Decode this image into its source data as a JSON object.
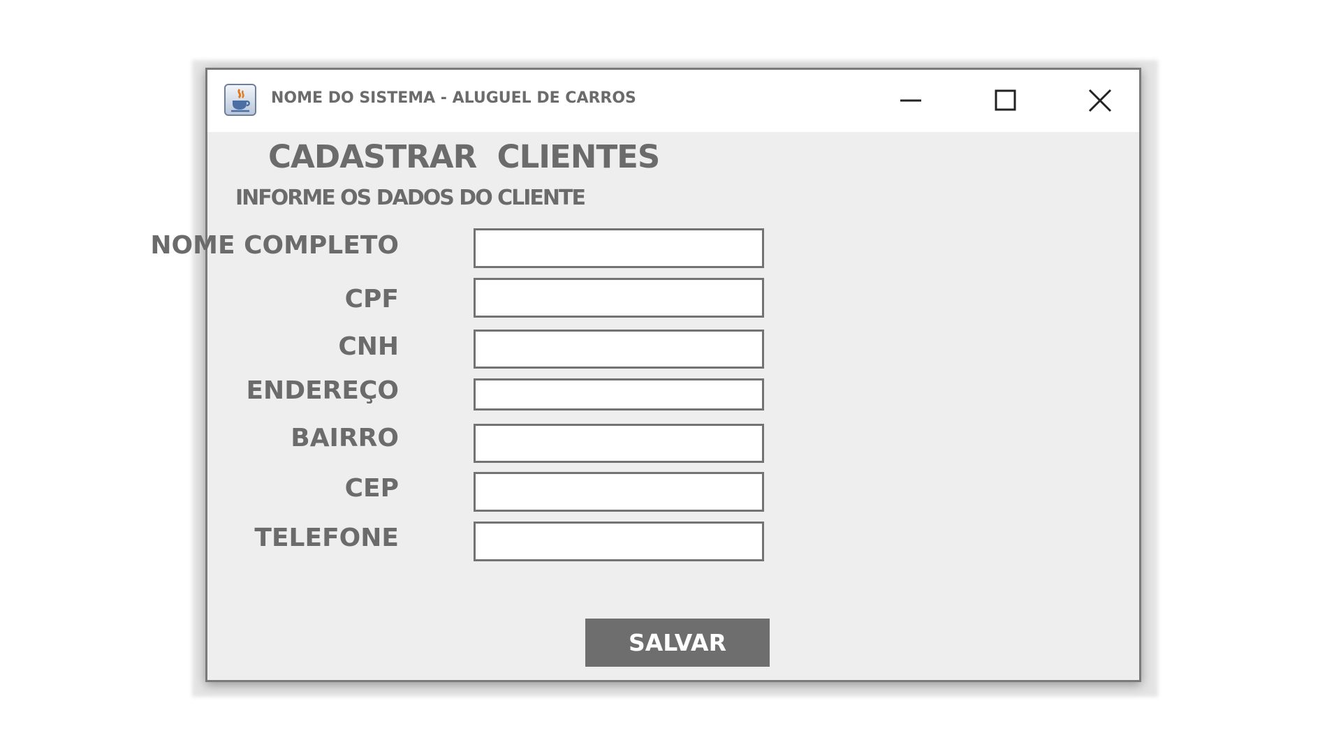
{
  "window": {
    "title": "NOME DO SISTEMA - ALUGUEL DE CARROS",
    "icon": "java-cup-icon",
    "controls": [
      "minimize-icon",
      "maximize-icon",
      "close-icon"
    ]
  },
  "form": {
    "heading": "CADASTRAR  CLIENTES",
    "subheading": "INFORME OS DADOS DO CLIENTE",
    "fields": [
      {
        "label": "NOME COMPLETO",
        "value": ""
      },
      {
        "label": "CPF",
        "value": ""
      },
      {
        "label": "CNH",
        "value": ""
      },
      {
        "label": "ENDEREÇO",
        "value": ""
      },
      {
        "label": "BAIRRO",
        "value": ""
      },
      {
        "label": "CEP",
        "value": ""
      },
      {
        "label": "TELEFONE",
        "value": ""
      }
    ],
    "save_label": "SALVAR"
  },
  "colors": {
    "text": "#6b6b6b",
    "button_bg": "#6e6e6e",
    "button_text": "#ffffff",
    "window_bg": "#eeeeee",
    "titlebar_bg": "#ffffff",
    "input_border": "#737373"
  }
}
